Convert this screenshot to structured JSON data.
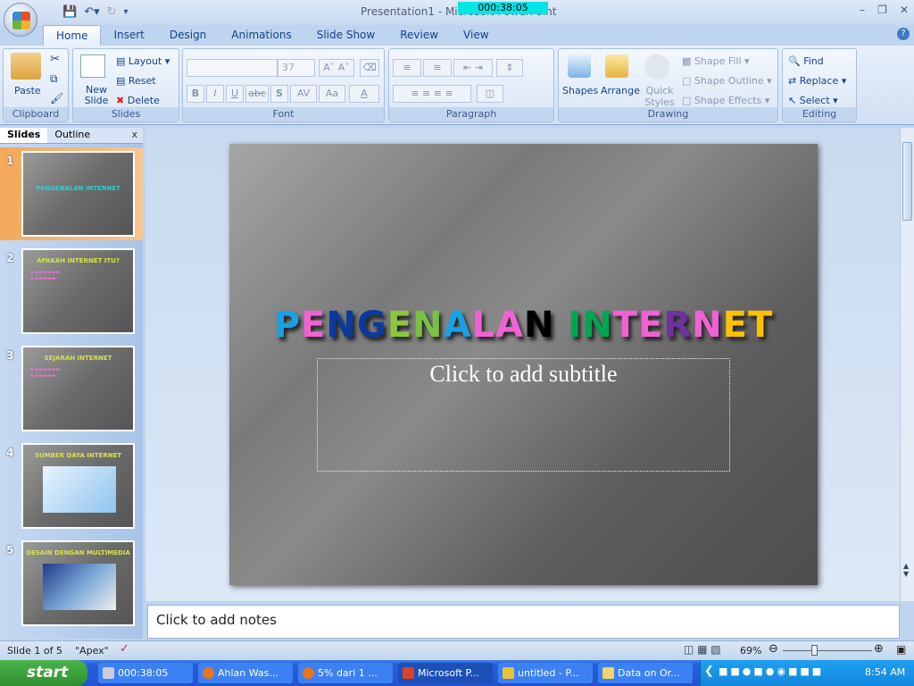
{
  "window": {
    "title": "Presentation1 - Microsoft PowerPoint",
    "timer": "000:38:05"
  },
  "ribbon": {
    "tabs": [
      "Home",
      "Insert",
      "Design",
      "Animations",
      "Slide Show",
      "Review",
      "View"
    ],
    "clipboard": {
      "label": "Clipboard",
      "paste": "Paste"
    },
    "slides": {
      "label": "Slides",
      "new_slide": "New Slide",
      "layout": "Layout",
      "reset": "Reset",
      "delete": "Delete"
    },
    "font": {
      "label": "Font",
      "font_name": "",
      "font_size": "37",
      "bold": "B",
      "italic": "I",
      "underline": "U",
      "strike": "abc",
      "shadow": "S",
      "spacing": "AV",
      "case": "Aa",
      "color": "A"
    },
    "paragraph": {
      "label": "Paragraph"
    },
    "drawing": {
      "label": "Drawing",
      "shapes": "Shapes",
      "arrange": "Arrange",
      "quick_styles": "Quick Styles",
      "shape_fill": "Shape Fill",
      "shape_outline": "Shape Outline",
      "shape_effects": "Shape Effects"
    },
    "editing": {
      "label": "Editing",
      "find": "Find",
      "replace": "Replace",
      "select": "Select"
    }
  },
  "pane": {
    "tabs": [
      "Slides",
      "Outline"
    ],
    "close": "x",
    "thumbnails": [
      {
        "num": "1",
        "title": "PENGENALAN INTERNET"
      },
      {
        "num": "2",
        "title": "APAKAH INTERNET ITU?"
      },
      {
        "num": "3",
        "title": "SEJARAH INTERNET"
      },
      {
        "num": "4",
        "title": "SUMBER DAYA INTERNET"
      },
      {
        "num": "5",
        "title": "DESAIN DENGAN MULTIMEDIA"
      }
    ]
  },
  "slide": {
    "title": "PENGENALAN INTERNET",
    "title_colors": [
      "#1ba1e2",
      "#f062d4",
      "#0a3a9e",
      "#0a3a9e",
      "#8cc63f",
      "#7ac143",
      "#1ba1e2",
      "#f062d4",
      "#f062d4",
      "#000000",
      "",
      "#00a651",
      "#00a651",
      "#f062d4",
      "#f062d4",
      "#7030a0",
      "#f062d4",
      "#ffc000",
      "#ffc000"
    ],
    "subtitle_placeholder": "Click to add subtitle"
  },
  "notes": {
    "placeholder": "Click to add notes"
  },
  "status": {
    "slide_info": "Slide 1 of 5",
    "theme": "\"Apex\"",
    "zoom": "69%",
    "zoom_level": 69
  },
  "taskbar": {
    "start": "start",
    "items": [
      "000:38:05",
      "Ahlan Was...",
      "5% dari 1 ...",
      "Microsoft P...",
      "untitled - P...",
      "Data on Or..."
    ],
    "clock": "8:54 AM"
  }
}
